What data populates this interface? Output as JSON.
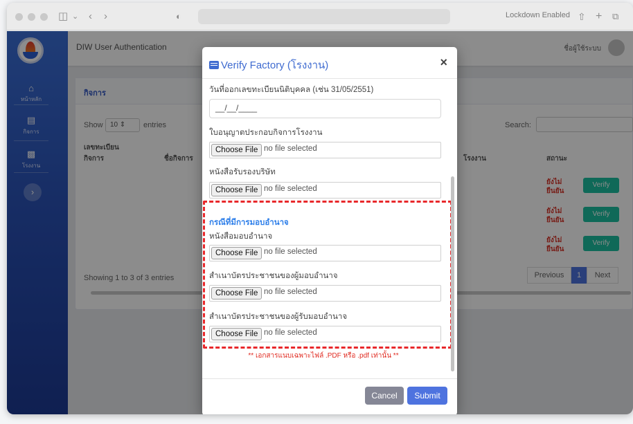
{
  "browser": {
    "lockdown_label": "Lockdown Enabled",
    "icons": [
      "sidebar-toggle-icon",
      "chevron-left-icon",
      "chevron-right-icon",
      "shield-icon",
      "share-icon",
      "plus-icon",
      "tabs-icon"
    ]
  },
  "app": {
    "title": "DIW User Authentication",
    "user_label": "ชื่อผู้ใช้ระบบ",
    "sidebar": {
      "items": [
        {
          "label": "หน้าหลัก",
          "icon": "home-icon"
        },
        {
          "label": "กิจการ",
          "icon": "document-icon"
        },
        {
          "label": "โรงงาน",
          "icon": "factory-icon"
        }
      ],
      "toggle_icon": "chevron-right-icon"
    }
  },
  "background_page": {
    "card_title": "กิจการ",
    "show_label": "Show",
    "entries_value": "10",
    "entries_label": "entries",
    "search_label": "Search:",
    "columns": [
      "เลขทะเบียน",
      "กิจการ",
      "ชื่อกิจการ",
      "โรงงาน",
      "สถานะ"
    ],
    "rows": [
      {
        "status": "ยังไม่ยืนยัน",
        "action": "Verify"
      },
      {
        "status": "ยังไม่ยืนยัน",
        "action": "Verify"
      },
      {
        "status": "ยังไม่ยืนยัน",
        "action": "Verify"
      }
    ],
    "info": "Showing 1 to 3 of 3 entries",
    "pager": {
      "previous": "Previous",
      "current": "1",
      "next": "Next"
    }
  },
  "modal": {
    "title": "Verify Factory (โรงงาน)",
    "close_symbol": "×",
    "date_label": "วันที่ออกเลขทะเบียนนิติบุคคล (เช่น 31/05/2551)",
    "date_value": "__/__/____",
    "files": [
      {
        "label": "ใบอนุญาตประกอบกิจการโรงงาน",
        "button": "Choose File",
        "status": "no file selected"
      },
      {
        "label": "หนังสือรับรองบริษัท",
        "button": "Choose File",
        "status": "no file selected"
      }
    ],
    "delegation_section_title": "กรณีที่มีการมอบอำนาจ",
    "delegation_files": [
      {
        "label": "หนังสือมอบอำนาจ",
        "button": "Choose File",
        "status": "no file selected"
      },
      {
        "label": "สำเนาบัตรประชาชนของผู้มอบอำนาจ",
        "button": "Choose File",
        "status": "no file selected"
      },
      {
        "label": "สำเนาบัตรประชาชนของผู้รับมอบอำนาจ",
        "button": "Choose File",
        "status": "no file selected"
      }
    ],
    "note": "** เอกสารแนบเฉพาะไฟล์ .PDF หรือ .pdf เท่านั้น **",
    "cancel_label": "Cancel",
    "submit_label": "Submit",
    "colors": {
      "primary": "#4e73df",
      "secondary": "#858796",
      "accent": "#2b7de9",
      "danger": "#e02a20",
      "verify": "#1cc0a0"
    }
  }
}
